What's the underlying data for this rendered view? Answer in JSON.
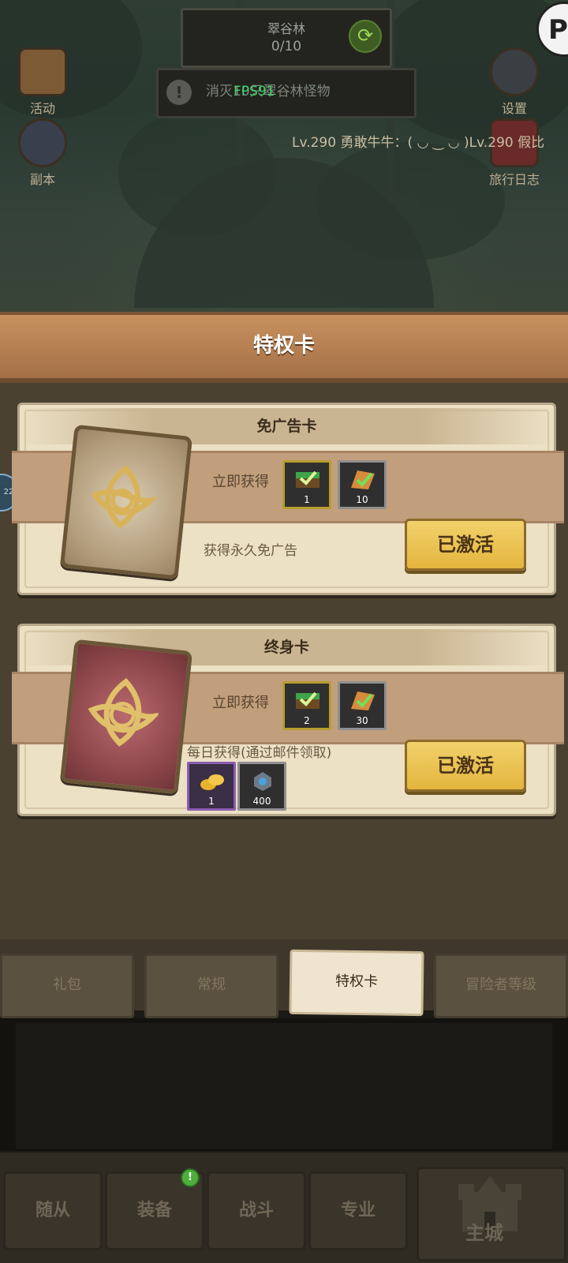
{
  "hud": {
    "zone_name": "翠谷林",
    "zone_progress": "0/10",
    "quest_text": "消灭10只翠谷林怪物",
    "fps": "FPS91",
    "activity_label": "活动",
    "dungeon_label": "副本",
    "settings_label": "设置",
    "journal_label": "旅行日志",
    "ticker": "Lv.290 勇敢牛牛：( ◡ ‿ ◡ )Lv.290 假比",
    "float_badge": "22"
  },
  "panel": {
    "title": "特权卡"
  },
  "cards": [
    {
      "name": "免广告卡",
      "instant_label": "立即获得",
      "instant_items": [
        {
          "icon": "green-chest-icon",
          "qty": "1"
        },
        {
          "icon": "green-ticket-icon",
          "qty": "10"
        }
      ],
      "description": "获得永久免广告",
      "button": "已激活"
    },
    {
      "name": "终身卡",
      "instant_label": "立即获得",
      "instant_items": [
        {
          "icon": "green-chest-icon",
          "qty": "2"
        },
        {
          "icon": "green-ticket-icon",
          "qty": "30"
        }
      ],
      "daily_label": "每日获得(通过邮件领取)",
      "daily_items": [
        {
          "icon": "gold-coins-icon",
          "qty": "1"
        },
        {
          "icon": "blue-gem-icon",
          "qty": "400"
        }
      ],
      "button": "已激活"
    }
  ],
  "subtabs": [
    "礼包",
    "常规",
    "特权卡",
    "冒险者等级"
  ],
  "active_subtab": "特权卡",
  "bottom_nav": {
    "items": [
      "随从",
      "装备",
      "战斗",
      "专业"
    ],
    "home": "主城",
    "badge": "!"
  },
  "colors": {
    "panel_title_bg": "#b57f52",
    "card_bg": "#ece0c5",
    "active_button": "#e4b53e",
    "fps_text": "#41d36a"
  }
}
